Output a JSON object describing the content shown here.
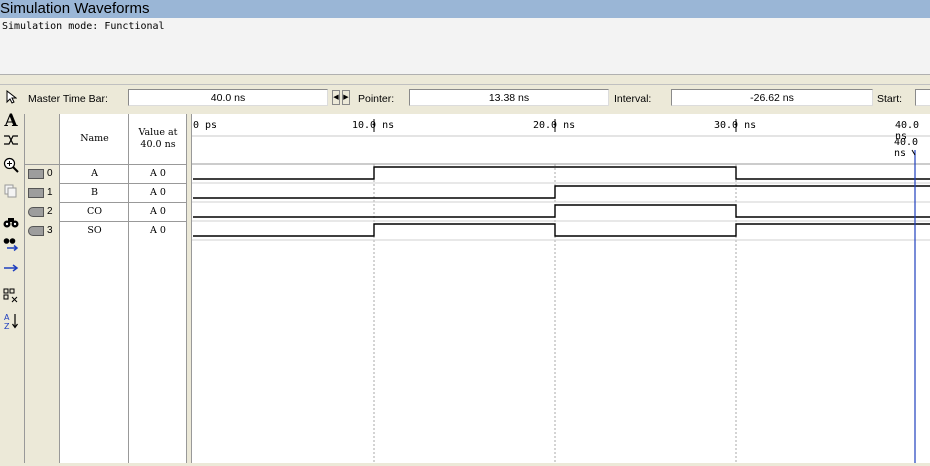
{
  "window": {
    "title": "Simulation Waveforms"
  },
  "mode_text": "Simulation mode: Functional",
  "timebar": {
    "master_label": "Master Time Bar:",
    "master_value": "40.0 ns",
    "pointer_label": "Pointer:",
    "pointer_value": "13.38 ns",
    "interval_label": "Interval:",
    "interval_value": "-26.62 ns",
    "start_label": "Start:"
  },
  "toolbar": {
    "icons": [
      "pointer-arrow-icon",
      "text-tool-icon",
      "waveform-edit-icon",
      "zoom-icon",
      "copy-icon",
      "find-icon",
      "replace-icon",
      "node-arrow-icon",
      "group-icon",
      "sort-icon"
    ]
  },
  "table": {
    "name_header": "Name",
    "value_header_line1": "Value at",
    "value_header_line2": "40.0 ns",
    "rows": [
      {
        "id": "0",
        "name": "A",
        "value": "A 0",
        "type": "input"
      },
      {
        "id": "1",
        "name": "B",
        "value": "A 0",
        "type": "input"
      },
      {
        "id": "2",
        "name": "CO",
        "value": "A 0",
        "type": "output"
      },
      {
        "id": "3",
        "name": "SO",
        "value": "A 0",
        "type": "output"
      }
    ]
  },
  "timeline": {
    "ticks": [
      "0 ps",
      "10.0 ns",
      "20.0 ns",
      "30.0 ns",
      "40.0 ns"
    ],
    "marker_label": "40.0 ns"
  },
  "waveforms": [
    {
      "signal": "A",
      "transitions_ns": [
        0,
        10,
        30
      ],
      "levels": [
        0,
        1,
        0
      ]
    },
    {
      "signal": "B",
      "transitions_ns": [
        0,
        20
      ],
      "levels": [
        0,
        1
      ]
    },
    {
      "signal": "CO",
      "transitions_ns": [
        0,
        20,
        30
      ],
      "levels": [
        0,
        1,
        0
      ]
    },
    {
      "signal": "SO",
      "transitions_ns": [
        0,
        10,
        20,
        30
      ],
      "levels": [
        0,
        1,
        0,
        1
      ]
    }
  ],
  "colors": {
    "title_bg": "#9ab6d6",
    "marker": "#1f3fbf",
    "wave": "#000000",
    "grid": "#a8a8a8"
  }
}
